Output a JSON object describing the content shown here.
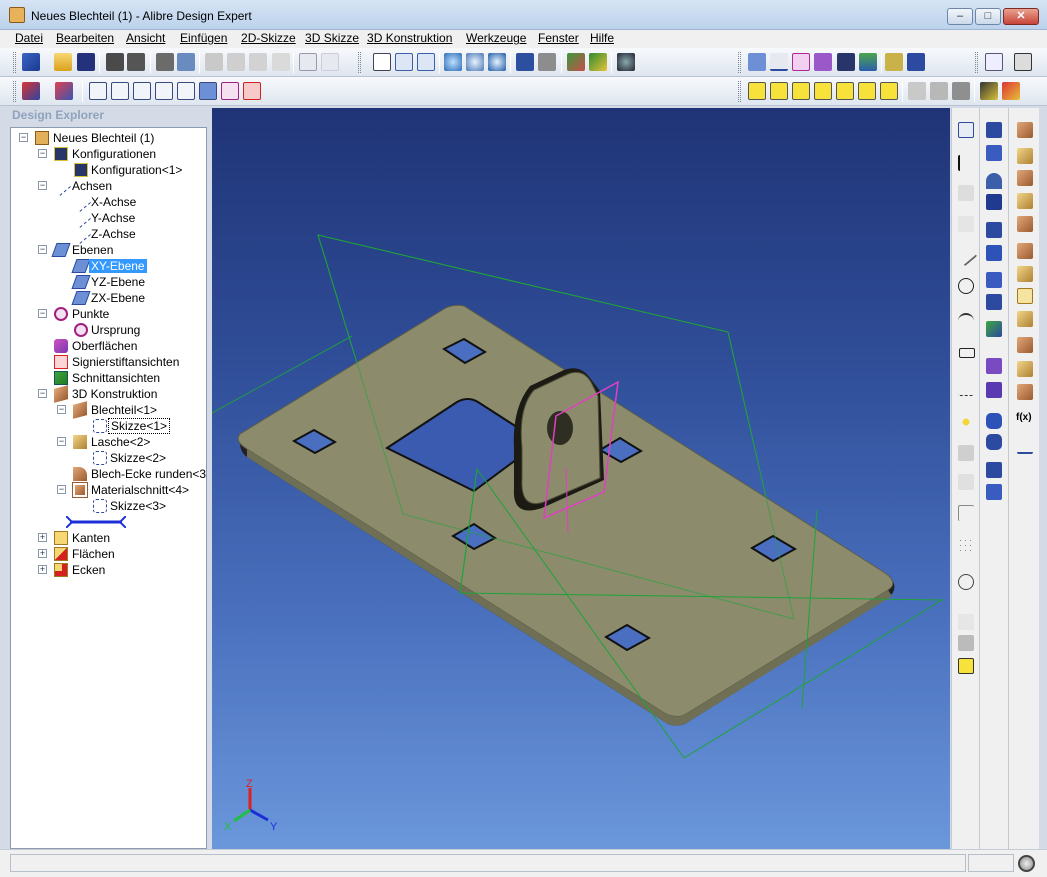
{
  "window": {
    "title": "Neues Blechteil (1) - Alibre Design Expert",
    "minimize": "–",
    "maximize": "□",
    "close": "✕"
  },
  "menu": [
    "Datei",
    "Bearbeiten",
    "Ansicht",
    "Einfügen",
    "2D-Skizze",
    "3D Skizze",
    "3D Konstruktion",
    "Werkzeuge",
    "Fenster",
    "Hilfe"
  ],
  "explorer": {
    "title": "Design Explorer",
    "tree": [
      {
        "label": "Neues Blechteil (1)",
        "icon": "part-icon",
        "expander": "−"
      },
      {
        "label": "Konfigurationen",
        "icon": "configurations-icon",
        "expander": "−"
      },
      {
        "label": "Konfiguration<1>",
        "icon": "configuration-icon",
        "expander": ""
      },
      {
        "label": "Achsen",
        "icon": "axes-icon",
        "expander": "−"
      },
      {
        "label": "X-Achse",
        "icon": "axis-icon",
        "expander": ""
      },
      {
        "label": "Y-Achse",
        "icon": "axis-icon",
        "expander": ""
      },
      {
        "label": "Z-Achse",
        "icon": "axis-icon",
        "expander": ""
      },
      {
        "label": "Ebenen",
        "icon": "planes-icon",
        "expander": "−"
      },
      {
        "label": "XY-Ebene",
        "icon": "plane-icon",
        "expander": ""
      },
      {
        "label": "YZ-Ebene",
        "icon": "plane-icon",
        "expander": ""
      },
      {
        "label": "ZX-Ebene",
        "icon": "plane-icon",
        "expander": ""
      },
      {
        "label": "Punkte",
        "icon": "points-icon",
        "expander": "−"
      },
      {
        "label": "Ursprung",
        "icon": "origin-icon",
        "expander": ""
      },
      {
        "label": "Oberflächen",
        "icon": "surfaces-icon",
        "expander": ""
      },
      {
        "label": "Signierstiftansichten",
        "icon": "redline-views-icon",
        "expander": ""
      },
      {
        "label": "Schnittansichten",
        "icon": "section-views-icon",
        "expander": ""
      },
      {
        "label": "3D Konstruktion",
        "icon": "design-features-icon",
        "expander": "−"
      },
      {
        "label": "Blechteil<1>",
        "icon": "sheet-metal-icon",
        "expander": "−"
      },
      {
        "label": "Skizze<1>",
        "icon": "sketch-icon",
        "expander": ""
      },
      {
        "label": "Lasche<2>",
        "icon": "tab-feature-icon",
        "expander": "−"
      },
      {
        "label": "Skizze<2>",
        "icon": "sketch-icon",
        "expander": ""
      },
      {
        "label": "Blech-Ecke runden<3>",
        "icon": "corner-round-icon",
        "expander": ""
      },
      {
        "label": "Materialschnitt<4>",
        "icon": "material-cut-icon",
        "expander": "−"
      },
      {
        "label": "Skizze<3>",
        "icon": "sketch-icon",
        "expander": ""
      },
      {
        "label": "Kanten",
        "icon": "edges-icon",
        "expander": "+"
      },
      {
        "label": "Flächen",
        "icon": "faces-icon",
        "expander": "+"
      },
      {
        "label": "Ecken",
        "icon": "vertices-icon",
        "expander": "+"
      }
    ]
  },
  "viewport": {
    "triad": {
      "x": "X",
      "y": "Y",
      "z": "Z"
    },
    "colors": {
      "part": "#8c8c6c",
      "plane": "#1ea33a",
      "sketch": "#e040c0",
      "background_top": "#1f3476",
      "background_bottom": "#6b97db"
    }
  },
  "right_strip": {
    "equation_label": "f(x)"
  }
}
